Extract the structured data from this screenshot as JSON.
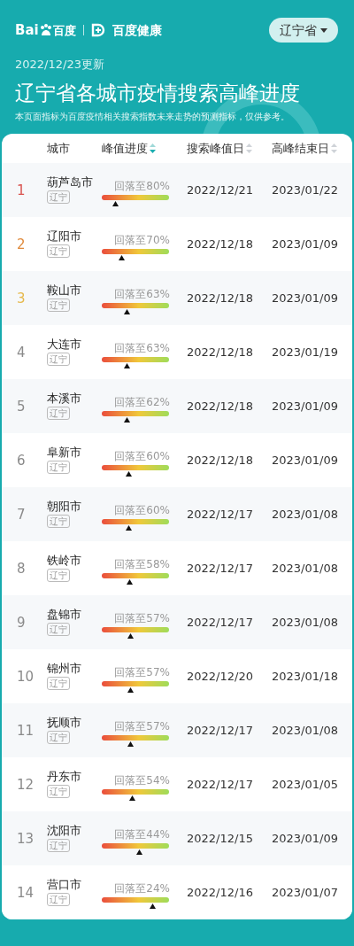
{
  "header": {
    "logo_text_1": "Bai",
    "logo_text_2": "百度",
    "brand": "百度健康",
    "province_button": "辽宁省"
  },
  "updated": "2022/12/23更新",
  "title": "辽宁省各城市疫情搜索高峰进度",
  "subtitle": "本页面指标为百度疫情相关搜索指数未来走势的预测指标，仅供参考。",
  "table": {
    "columns": [
      {
        "label": "城市"
      },
      {
        "label": "峰值进度",
        "sortable": true,
        "sorted": true
      },
      {
        "label": "搜索峰值日",
        "sortable": true,
        "sorted": false
      },
      {
        "label": "高峰结束日",
        "sortable": true,
        "sorted": false
      }
    ],
    "rows": [
      {
        "rank": "1",
        "color": "#d9534f",
        "city": "葫芦岛市",
        "tag": "辽宁",
        "progress": "回落至80%",
        "level": 0.21,
        "peak": "2022/12/21",
        "end": "2023/01/22"
      },
      {
        "rank": "2",
        "color": "#e08a3c",
        "city": "辽阳市",
        "tag": "辽宁",
        "progress": "回落至70%",
        "level": 0.3,
        "peak": "2022/12/18",
        "end": "2023/01/09"
      },
      {
        "rank": "3",
        "color": "#e6b84a",
        "city": "鞍山市",
        "tag": "辽宁",
        "progress": "回落至63%",
        "level": 0.37,
        "peak": "2022/12/18",
        "end": "2023/01/09"
      },
      {
        "rank": "4",
        "color": "#8a8a8a",
        "city": "大连市",
        "tag": "辽宁",
        "progress": "回落至63%",
        "level": 0.37,
        "peak": "2022/12/18",
        "end": "2023/01/19"
      },
      {
        "rank": "5",
        "color": "#8a8a8a",
        "city": "本溪市",
        "tag": "辽宁",
        "progress": "回落至62%",
        "level": 0.38,
        "peak": "2022/12/18",
        "end": "2023/01/09"
      },
      {
        "rank": "6",
        "color": "#8a8a8a",
        "city": "阜新市",
        "tag": "辽宁",
        "progress": "回落至60%",
        "level": 0.4,
        "peak": "2022/12/18",
        "end": "2023/01/09"
      },
      {
        "rank": "7",
        "color": "#8a8a8a",
        "city": "朝阳市",
        "tag": "辽宁",
        "progress": "回落至60%",
        "level": 0.4,
        "peak": "2022/12/17",
        "end": "2023/01/08"
      },
      {
        "rank": "8",
        "color": "#8a8a8a",
        "city": "铁岭市",
        "tag": "辽宁",
        "progress": "回落至58%",
        "level": 0.42,
        "peak": "2022/12/17",
        "end": "2023/01/08"
      },
      {
        "rank": "9",
        "color": "#8a8a8a",
        "city": "盘锦市",
        "tag": "辽宁",
        "progress": "回落至57%",
        "level": 0.43,
        "peak": "2022/12/17",
        "end": "2023/01/08"
      },
      {
        "rank": "10",
        "color": "#8a8a8a",
        "city": "锦州市",
        "tag": "辽宁",
        "progress": "回落至57%",
        "level": 0.43,
        "peak": "2022/12/20",
        "end": "2023/01/18"
      },
      {
        "rank": "11",
        "color": "#8a8a8a",
        "city": "抚顺市",
        "tag": "辽宁",
        "progress": "回落至57%",
        "level": 0.43,
        "peak": "2022/12/17",
        "end": "2023/01/08"
      },
      {
        "rank": "12",
        "color": "#8a8a8a",
        "city": "丹东市",
        "tag": "辽宁",
        "progress": "回落至54%",
        "level": 0.46,
        "peak": "2022/12/17",
        "end": "2023/01/05"
      },
      {
        "rank": "13",
        "color": "#8a8a8a",
        "city": "沈阳市",
        "tag": "辽宁",
        "progress": "回落至44%",
        "level": 0.56,
        "peak": "2022/12/15",
        "end": "2023/01/09"
      },
      {
        "rank": "14",
        "color": "#8a8a8a",
        "city": "营口市",
        "tag": "辽宁",
        "progress": "回落至24%",
        "level": 0.76,
        "peak": "2022/12/16",
        "end": "2023/01/07"
      }
    ]
  }
}
